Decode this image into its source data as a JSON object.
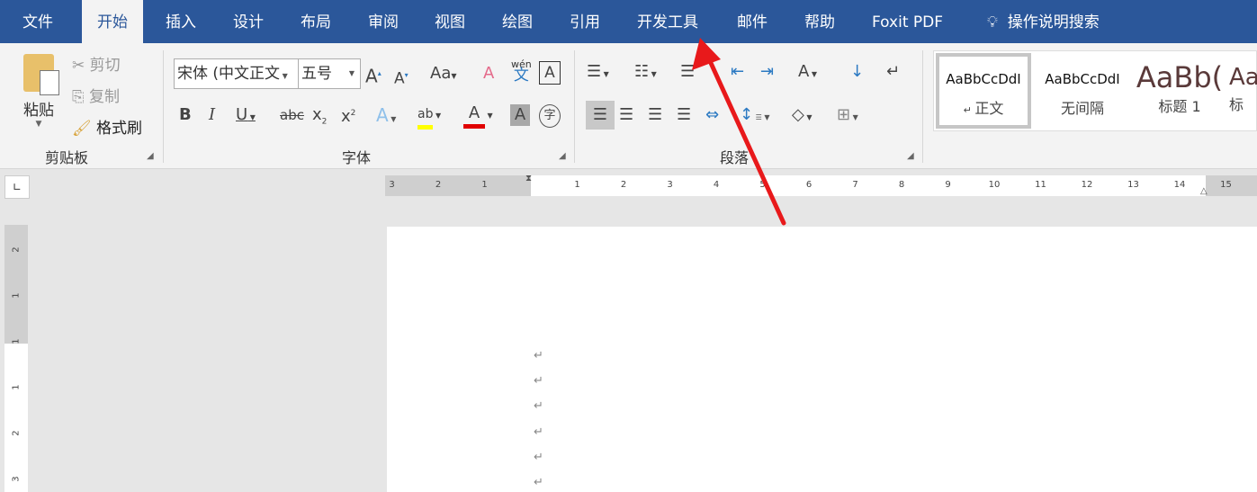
{
  "tabs": [
    "文件",
    "开始",
    "插入",
    "设计",
    "布局",
    "审阅",
    "视图",
    "绘图",
    "引用",
    "开发工具",
    "邮件",
    "帮助",
    "Foxit PDF"
  ],
  "tell_me": "操作说明搜索",
  "clipboard": {
    "paste": "粘贴",
    "cut": "剪切",
    "copy": "复制",
    "format_painter": "格式刷",
    "group": "剪贴板"
  },
  "font": {
    "name": "宋体 (中文正文",
    "size": "五号",
    "change_case": "Aa",
    "phonetic": "wén",
    "phonetic_char": "文",
    "group": "字体"
  },
  "paragraph": {
    "group": "段落"
  },
  "styles": [
    {
      "preview": "AaBbCcDdI",
      "name": "正文"
    },
    {
      "preview": "AaBbCcDdI",
      "name": "无间隔"
    },
    {
      "preview": "AaBb(",
      "name": "标题 1"
    },
    {
      "preview": "Aa",
      "name": "标"
    }
  ],
  "ruler": {
    "left": [
      "3",
      "2",
      "1"
    ],
    "right": [
      "1",
      "2",
      "3",
      "4",
      "5",
      "6",
      "7",
      "8",
      "9",
      "10",
      "11",
      "12",
      "13",
      "14",
      "15"
    ]
  },
  "vruler": [
    "2",
    "1",
    "1",
    "1",
    "2",
    "3"
  ],
  "paragraph_mark": "↵",
  "colors": {
    "accent": "#2b579a",
    "highlight": "#ffff00",
    "font_color": "#e00000",
    "arrow": "#e8191b"
  }
}
